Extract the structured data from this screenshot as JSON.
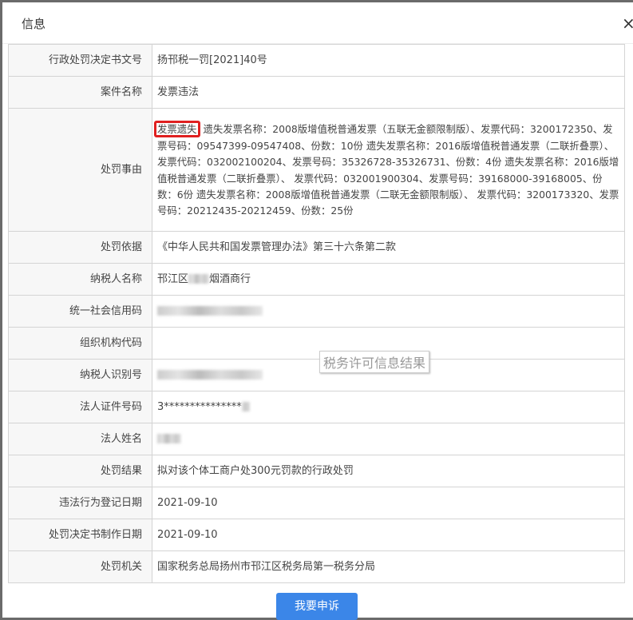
{
  "dialog": {
    "title": "信息",
    "close": "×"
  },
  "rows": [
    {
      "label": "行政处罚决定书文号",
      "value": "扬邗税一罚[2021]40号"
    },
    {
      "label": "案件名称",
      "value": "发票违法"
    },
    {
      "label": "处罚事由",
      "highlight": "发票遗失",
      "value": "遗失发票名称：2008版增值税普通发票（五联无金额限制版）、发票代码：3200172350、发票号码：09547399-09547408、份数：10份 遗失发票名称：2016版增值税普通发票（二联折叠票）、 发票代码：032002100204、发票号码：35326728-35326731、份数：4份 遗失发票名称：2016版增值税普通发票（二联折叠票）、 发票代码：032001900304、发票号码：39168000-39168005、份数：6份 遗失发票名称：2008版增值税普通发票（二联无金额限制版）、 发票代码：3200173320、发票号码：20212435-20212459、份数：25份"
    },
    {
      "label": "处罚依据",
      "value": "《中华人民共和国发票管理办法》第三十六条第二款"
    },
    {
      "label": "纳税人名称",
      "value_prefix": "邗江区",
      "value_suffix": "烟酒商行"
    },
    {
      "label": "统一社会信用码",
      "value": ""
    },
    {
      "label": "组织机构代码",
      "value": ""
    },
    {
      "label": "纳税人识别号",
      "value": ""
    },
    {
      "label": "法人证件号码",
      "value": "3***************"
    },
    {
      "label": "法人姓名",
      "value": ""
    },
    {
      "label": "处罚结果",
      "value": "拟对该个体工商户处300元罚款的行政处罚"
    },
    {
      "label": "违法行为登记日期",
      "value": "2021-09-10"
    },
    {
      "label": "处罚决定书制作日期",
      "value": "2021-09-10"
    },
    {
      "label": "处罚机关",
      "value": "国家税务总局扬州市邗江区税务局第一税务分局"
    }
  ],
  "watermark": "税务许可信息结果",
  "appeal_button": "我要申诉"
}
